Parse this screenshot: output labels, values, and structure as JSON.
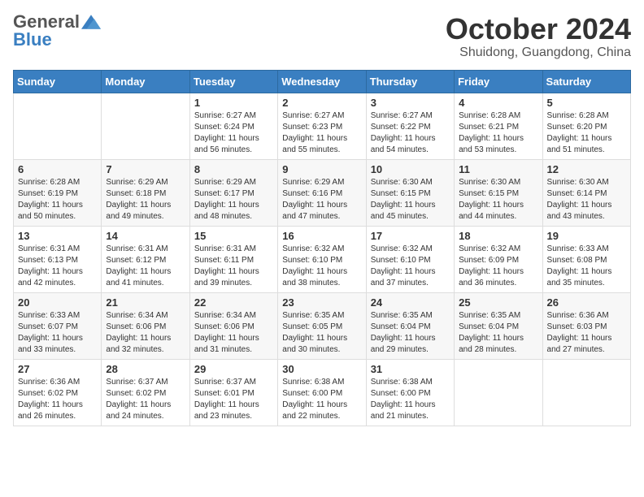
{
  "logo": {
    "general": "General",
    "blue": "Blue"
  },
  "header": {
    "month": "October 2024",
    "location": "Shuidong, Guangdong, China"
  },
  "weekdays": [
    "Sunday",
    "Monday",
    "Tuesday",
    "Wednesday",
    "Thursday",
    "Friday",
    "Saturday"
  ],
  "weeks": [
    [
      {
        "day": "",
        "info": ""
      },
      {
        "day": "",
        "info": ""
      },
      {
        "day": "1",
        "info": "Sunrise: 6:27 AM\nSunset: 6:24 PM\nDaylight: 11 hours and 56 minutes."
      },
      {
        "day": "2",
        "info": "Sunrise: 6:27 AM\nSunset: 6:23 PM\nDaylight: 11 hours and 55 minutes."
      },
      {
        "day": "3",
        "info": "Sunrise: 6:27 AM\nSunset: 6:22 PM\nDaylight: 11 hours and 54 minutes."
      },
      {
        "day": "4",
        "info": "Sunrise: 6:28 AM\nSunset: 6:21 PM\nDaylight: 11 hours and 53 minutes."
      },
      {
        "day": "5",
        "info": "Sunrise: 6:28 AM\nSunset: 6:20 PM\nDaylight: 11 hours and 51 minutes."
      }
    ],
    [
      {
        "day": "6",
        "info": "Sunrise: 6:28 AM\nSunset: 6:19 PM\nDaylight: 11 hours and 50 minutes."
      },
      {
        "day": "7",
        "info": "Sunrise: 6:29 AM\nSunset: 6:18 PM\nDaylight: 11 hours and 49 minutes."
      },
      {
        "day": "8",
        "info": "Sunrise: 6:29 AM\nSunset: 6:17 PM\nDaylight: 11 hours and 48 minutes."
      },
      {
        "day": "9",
        "info": "Sunrise: 6:29 AM\nSunset: 6:16 PM\nDaylight: 11 hours and 47 minutes."
      },
      {
        "day": "10",
        "info": "Sunrise: 6:30 AM\nSunset: 6:15 PM\nDaylight: 11 hours and 45 minutes."
      },
      {
        "day": "11",
        "info": "Sunrise: 6:30 AM\nSunset: 6:15 PM\nDaylight: 11 hours and 44 minutes."
      },
      {
        "day": "12",
        "info": "Sunrise: 6:30 AM\nSunset: 6:14 PM\nDaylight: 11 hours and 43 minutes."
      }
    ],
    [
      {
        "day": "13",
        "info": "Sunrise: 6:31 AM\nSunset: 6:13 PM\nDaylight: 11 hours and 42 minutes."
      },
      {
        "day": "14",
        "info": "Sunrise: 6:31 AM\nSunset: 6:12 PM\nDaylight: 11 hours and 41 minutes."
      },
      {
        "day": "15",
        "info": "Sunrise: 6:31 AM\nSunset: 6:11 PM\nDaylight: 11 hours and 39 minutes."
      },
      {
        "day": "16",
        "info": "Sunrise: 6:32 AM\nSunset: 6:10 PM\nDaylight: 11 hours and 38 minutes."
      },
      {
        "day": "17",
        "info": "Sunrise: 6:32 AM\nSunset: 6:10 PM\nDaylight: 11 hours and 37 minutes."
      },
      {
        "day": "18",
        "info": "Sunrise: 6:32 AM\nSunset: 6:09 PM\nDaylight: 11 hours and 36 minutes."
      },
      {
        "day": "19",
        "info": "Sunrise: 6:33 AM\nSunset: 6:08 PM\nDaylight: 11 hours and 35 minutes."
      }
    ],
    [
      {
        "day": "20",
        "info": "Sunrise: 6:33 AM\nSunset: 6:07 PM\nDaylight: 11 hours and 33 minutes."
      },
      {
        "day": "21",
        "info": "Sunrise: 6:34 AM\nSunset: 6:06 PM\nDaylight: 11 hours and 32 minutes."
      },
      {
        "day": "22",
        "info": "Sunrise: 6:34 AM\nSunset: 6:06 PM\nDaylight: 11 hours and 31 minutes."
      },
      {
        "day": "23",
        "info": "Sunrise: 6:35 AM\nSunset: 6:05 PM\nDaylight: 11 hours and 30 minutes."
      },
      {
        "day": "24",
        "info": "Sunrise: 6:35 AM\nSunset: 6:04 PM\nDaylight: 11 hours and 29 minutes."
      },
      {
        "day": "25",
        "info": "Sunrise: 6:35 AM\nSunset: 6:04 PM\nDaylight: 11 hours and 28 minutes."
      },
      {
        "day": "26",
        "info": "Sunrise: 6:36 AM\nSunset: 6:03 PM\nDaylight: 11 hours and 27 minutes."
      }
    ],
    [
      {
        "day": "27",
        "info": "Sunrise: 6:36 AM\nSunset: 6:02 PM\nDaylight: 11 hours and 26 minutes."
      },
      {
        "day": "28",
        "info": "Sunrise: 6:37 AM\nSunset: 6:02 PM\nDaylight: 11 hours and 24 minutes."
      },
      {
        "day": "29",
        "info": "Sunrise: 6:37 AM\nSunset: 6:01 PM\nDaylight: 11 hours and 23 minutes."
      },
      {
        "day": "30",
        "info": "Sunrise: 6:38 AM\nSunset: 6:00 PM\nDaylight: 11 hours and 22 minutes."
      },
      {
        "day": "31",
        "info": "Sunrise: 6:38 AM\nSunset: 6:00 PM\nDaylight: 11 hours and 21 minutes."
      },
      {
        "day": "",
        "info": ""
      },
      {
        "day": "",
        "info": ""
      }
    ]
  ]
}
